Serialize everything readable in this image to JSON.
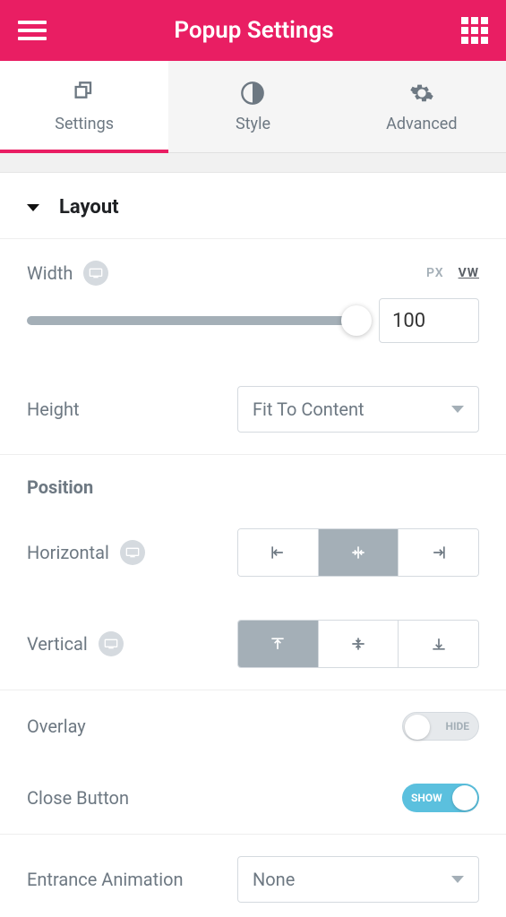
{
  "header": {
    "title": "Popup Settings"
  },
  "tabs": [
    {
      "label": "Settings",
      "active": true
    },
    {
      "label": "Style",
      "active": false
    },
    {
      "label": "Advanced",
      "active": false
    }
  ],
  "section": {
    "layout_label": "Layout"
  },
  "width": {
    "label": "Width",
    "value": "100",
    "units": {
      "px": "PX",
      "vw": "VW",
      "active": "vw"
    }
  },
  "height": {
    "label": "Height",
    "value": "Fit To Content"
  },
  "position": {
    "label": "Position",
    "horizontal": {
      "label": "Horizontal",
      "active": "center"
    },
    "vertical": {
      "label": "Vertical",
      "active": "top"
    }
  },
  "overlay": {
    "label": "Overlay",
    "state": "HIDE"
  },
  "close_button": {
    "label": "Close Button",
    "state": "SHOW"
  },
  "entrance": {
    "label": "Entrance Animation",
    "value": "None"
  }
}
